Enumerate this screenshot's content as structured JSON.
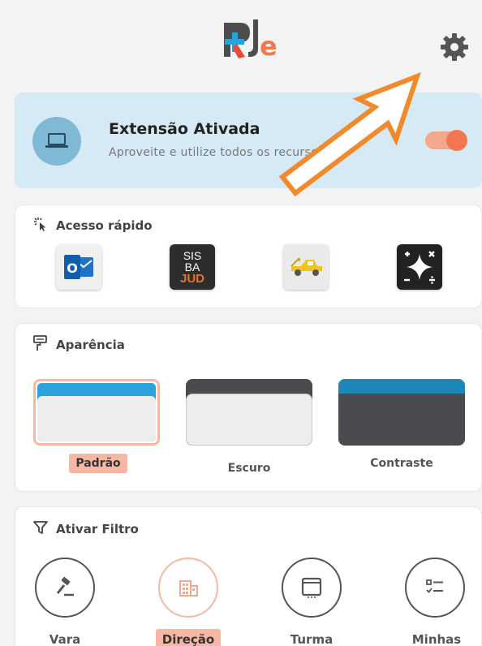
{
  "logo_text": "PJe",
  "icons": {
    "settings": "gear-icon",
    "laptop": "laptop-icon",
    "quick_access": "pointer-click-icon",
    "appearance": "paint-roller-icon",
    "filter": "filter-icon"
  },
  "extension": {
    "title": "Extensão Ativada",
    "subtitle": "Aproveite e utilize todos os recursos",
    "toggle_on": true
  },
  "quick_access": {
    "title": "Acesso rápido",
    "items": [
      {
        "name": "outlook",
        "icon": "outlook-icon",
        "text": "O"
      },
      {
        "name": "sisbajud",
        "line1": "SIS",
        "line2": "BA",
        "line3": "JUD"
      },
      {
        "name": "tow-truck",
        "icon": "tow-truck-icon"
      },
      {
        "name": "calculator",
        "icon": "calculator-icon"
      }
    ]
  },
  "appearance": {
    "title": "Aparência",
    "themes": [
      {
        "label": "Padrão",
        "selected": true
      },
      {
        "label": "Escuro",
        "selected": false
      },
      {
        "label": "Contraste",
        "selected": false
      }
    ]
  },
  "filter": {
    "title": "Ativar Filtro",
    "items": [
      {
        "label": "Vara",
        "icon": "gavel-icon",
        "selected": false
      },
      {
        "label": "Direção",
        "icon": "building-icon",
        "selected": true
      },
      {
        "label": "Turma",
        "icon": "screen-icon",
        "selected": false
      },
      {
        "label": "Minhas",
        "icon": "checklist-icon",
        "selected": false
      }
    ]
  },
  "colors": {
    "accent": "#f2764f",
    "accent_light": "#f6b8a4",
    "blue": "#2aa3dc",
    "dark": "#4a4b4f"
  }
}
